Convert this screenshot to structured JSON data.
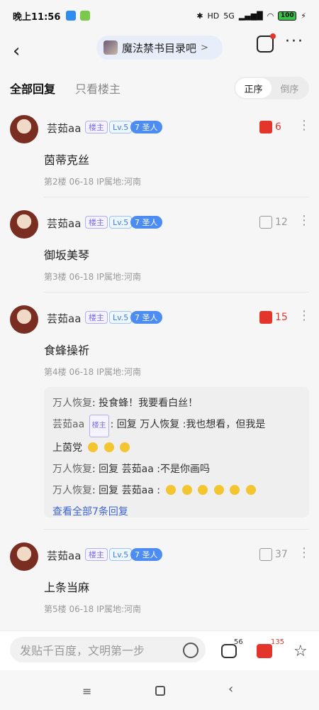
{
  "status": {
    "time": "晚上11:56",
    "hd": "HD",
    "net": "5G",
    "battery": "100"
  },
  "nav": {
    "back": "‹",
    "forum_name": "魔法禁书目录吧",
    "forum_arrow": ">",
    "more": "···"
  },
  "tabs": {
    "all": "全部回复",
    "host_only": "只看楼主"
  },
  "sort": {
    "asc": "正序",
    "desc": "倒序"
  },
  "badges": {
    "host": "楼主",
    "level": "Lv.5",
    "saint": "7 圣人"
  },
  "posts": [
    {
      "user": "芸茹aa",
      "content": "茵蒂克丝",
      "meta": "第2楼   06-18   IP属地:河南",
      "likes": "6"
    },
    {
      "user": "芸茹aa",
      "content": "御坂美琴",
      "meta": "第3楼   06-18   IP属地:河南",
      "likes": "12"
    },
    {
      "user": "芸茹aa",
      "content": "食蜂操祈",
      "meta": "第4楼   06-18   IP属地:河南",
      "likes": "15"
    },
    {
      "user": "芸茹aa",
      "content": "上条当麻",
      "meta": "第5楼   06-18   IP属地:河南",
      "likes": "37"
    }
  ],
  "replies": {
    "r1_name": "万人恢复",
    "r1_text": ": 投食蜂！我要看白丝！",
    "r2_name": "芸茹aa",
    "r2_text": ": 回复 万人恢复 :我也想看，但我是",
    "r2_cont": "上茵党",
    "r3_name": "万人恢复",
    "r3_text": ": 回复 芸茹aa :不是你画吗",
    "r4_name": "万人恢复",
    "r4_text": ": 回复 芸茹aa :",
    "view_all": "查看全部7条回复"
  },
  "bottom": {
    "placeholder": "发贴千百度，文明第一步",
    "comments": "56",
    "likes": "135"
  },
  "android": {
    "menu": "≡",
    "back": "‹"
  }
}
